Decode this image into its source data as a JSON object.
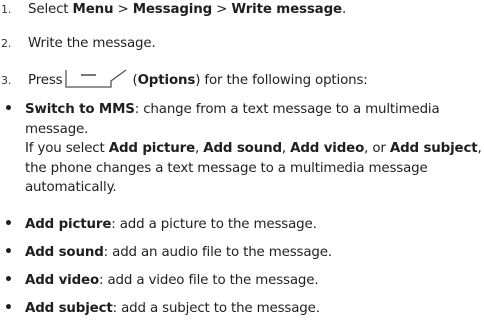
{
  "steps": [
    {
      "num": "1.",
      "text_a": "Select ",
      "b1": "Menu",
      "sep1": " > ",
      "b2": "Messaging",
      "sep2": " > ",
      "b3": "Write message",
      "end": "."
    },
    {
      "num": "2.",
      "text": "Write the message."
    },
    {
      "num": "3.",
      "text_a": "Press",
      "paren_open": "(",
      "bold": "Options",
      "text_b": ") for the following options:",
      "icon": "softkey-left-icon"
    }
  ],
  "options": [
    {
      "name": "Switch to MMS",
      "desc": ": change from a text message to a multimedia message."
    },
    {
      "name": "Add picture",
      "desc": ": add a picture to the message."
    },
    {
      "name": "Add sound",
      "desc": ": add an audio file to the message."
    },
    {
      "name": "Add video",
      "desc": ": add a video file to the message."
    },
    {
      "name": "Add subject",
      "desc": ": add a subject to the message."
    }
  ],
  "note": {
    "t1": "If you select ",
    "b1": "Add picture",
    "t2": ", ",
    "b2": "Add sound",
    "t3": ", ",
    "b3": "Add video",
    "t4": ", or ",
    "b4": "Add subject",
    "t5": ", the phone changes a text message to a multimedia message automatically."
  },
  "bullet_glyph": "•"
}
